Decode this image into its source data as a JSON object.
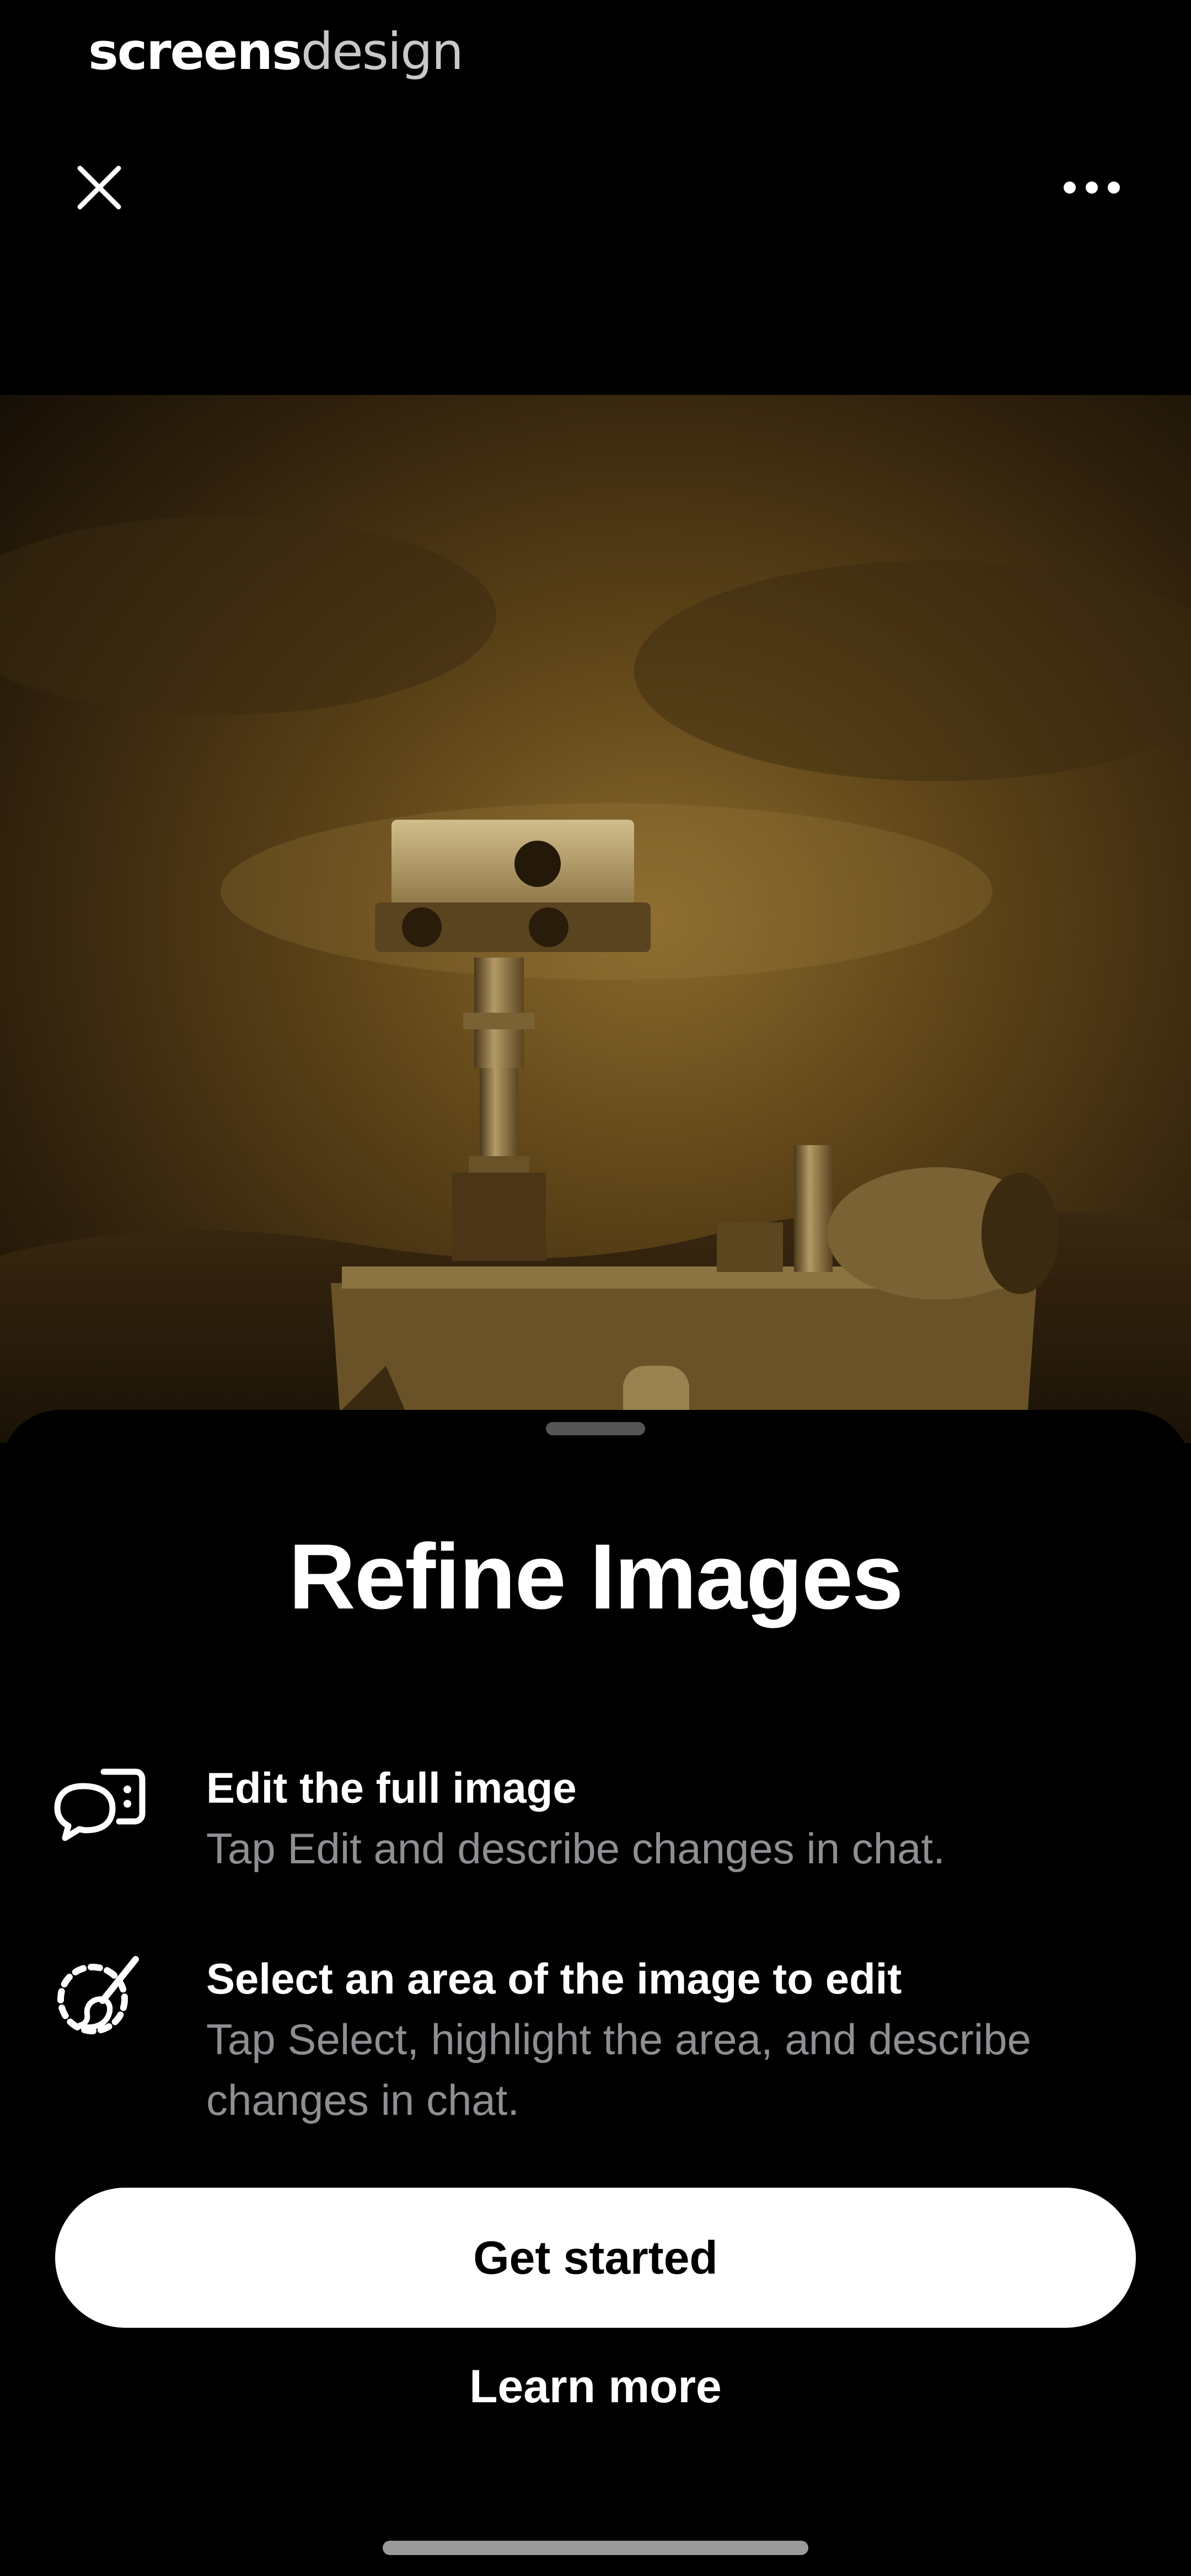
{
  "watermark": {
    "part1": "screens",
    "part2": "design"
  },
  "header": {
    "close_icon": "close-icon",
    "more_icon": "more-horizontal-icon"
  },
  "artwork": {
    "subject": "robot-rover-painting"
  },
  "sheet": {
    "title": "Refine Images",
    "features": [
      {
        "icon": "chat-bubbles-icon",
        "title": "Edit the full image",
        "description": "Tap Edit and describe changes in chat."
      },
      {
        "icon": "select-brush-icon",
        "title": "Select an area of the image to edit",
        "description": "Tap Select, highlight the area, and describe changes in chat."
      }
    ],
    "primary_button": "Get started",
    "secondary_button": "Learn more"
  },
  "colors": {
    "background": "#000000",
    "text_primary": "#ffffff",
    "text_secondary": "#8e8e93",
    "button_bg": "#ffffff",
    "button_text": "#000000"
  }
}
